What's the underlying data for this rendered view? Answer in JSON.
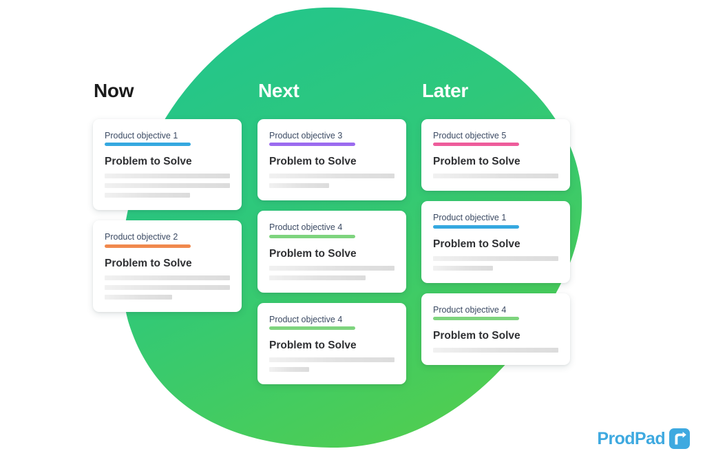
{
  "page": {
    "background_color": "#ffffff",
    "blob_gradient_from": "#25C08B",
    "blob_gradient_to": "#4CCB4C"
  },
  "columns": [
    {
      "id": "now",
      "title": "Now",
      "title_color": "#1b1b1b",
      "cards": [
        {
          "objective": "Product objective 1",
          "accent_color": "#35A8E0",
          "title": "Problem to Solve",
          "skeleton_widths": [
            "100%",
            "100%",
            "68%"
          ]
        },
        {
          "objective": "Product objective 2",
          "accent_color": "#F0894D",
          "title": "Problem to Solve",
          "skeleton_widths": [
            "100%",
            "100%",
            "54%"
          ]
        }
      ]
    },
    {
      "id": "next",
      "title": "Next",
      "title_color": "#ffffff",
      "cards": [
        {
          "objective": "Product objective 3",
          "accent_color": "#9B6BEF",
          "title": "Problem to Solve",
          "skeleton_widths": [
            "100%",
            "48%"
          ]
        },
        {
          "objective": "Product objective 4",
          "accent_color": "#7ED47E",
          "title": "Problem to Solve",
          "skeleton_widths": [
            "100%",
            "77%"
          ]
        },
        {
          "objective": "Product objective 4",
          "accent_color": "#7ED47E",
          "title": "Problem to Solve",
          "skeleton_widths": [
            "100%",
            "32%"
          ]
        }
      ]
    },
    {
      "id": "later",
      "title": "Later",
      "title_color": "#ffffff",
      "cards": [
        {
          "objective": "Product objective 5",
          "accent_color": "#EE5D9B",
          "title": "Problem to Solve",
          "skeleton_widths": [
            "100%"
          ]
        },
        {
          "objective": "Product objective 1",
          "accent_color": "#35A8E0",
          "title": "Problem to Solve",
          "skeleton_widths": [
            "100%",
            "48%"
          ]
        },
        {
          "objective": "Product objective 4",
          "accent_color": "#7ED47E",
          "title": "Problem to Solve",
          "skeleton_widths": [
            "100%"
          ]
        }
      ]
    }
  ],
  "logo": {
    "wordmark": "ProdPad",
    "mark_icon": "arrow-up-right-icon",
    "color": "#3EA9E0"
  }
}
